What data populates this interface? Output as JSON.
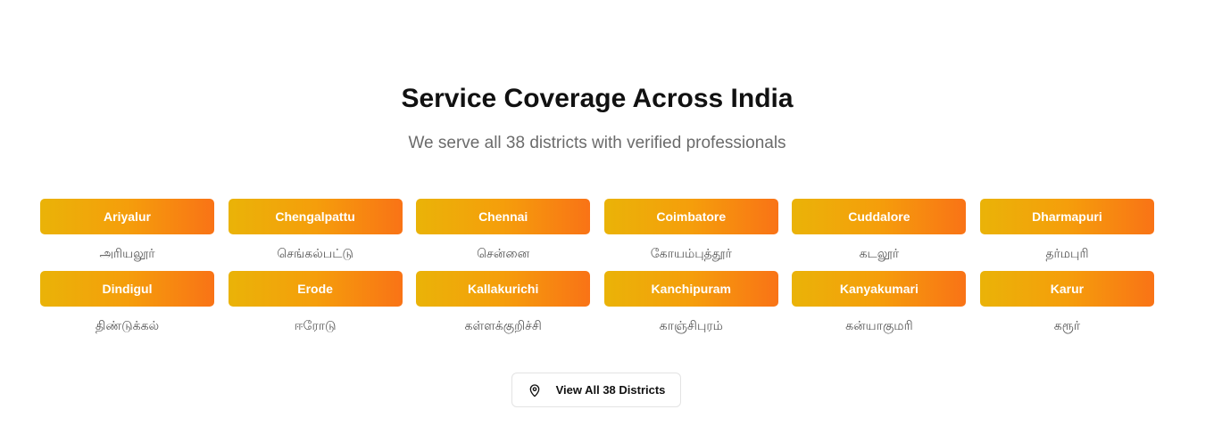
{
  "section": {
    "title": "Service Coverage Across India",
    "subtitle": "We serve all 38 districts with verified professionals"
  },
  "districts": [
    {
      "name": "Ariyalur",
      "tamil": "அரியலூர்"
    },
    {
      "name": "Chengalpattu",
      "tamil": "செங்கல்பட்டு"
    },
    {
      "name": "Chennai",
      "tamil": "சென்னை"
    },
    {
      "name": "Coimbatore",
      "tamil": "கோயம்புத்தூர்"
    },
    {
      "name": "Cuddalore",
      "tamil": "கடலூர்"
    },
    {
      "name": "Dharmapuri",
      "tamil": "தர்மபுரி"
    },
    {
      "name": "Dindigul",
      "tamil": "திண்டுக்கல்"
    },
    {
      "name": "Erode",
      "tamil": "ஈரோடு"
    },
    {
      "name": "Kallakurichi",
      "tamil": "கள்ளக்குறிச்சி"
    },
    {
      "name": "Kanchipuram",
      "tamil": "காஞ்சிபுரம்"
    },
    {
      "name": "Kanyakumari",
      "tamil": "கன்யாகுமரி"
    },
    {
      "name": "Karur",
      "tamil": "கரூர்"
    }
  ],
  "view_all": {
    "label": "View All 38 Districts",
    "icon": "map-pin-icon"
  },
  "colors": {
    "gradient_start": "#eab308",
    "gradient_end": "#f97316",
    "subtitle": "#6b6b6b"
  }
}
